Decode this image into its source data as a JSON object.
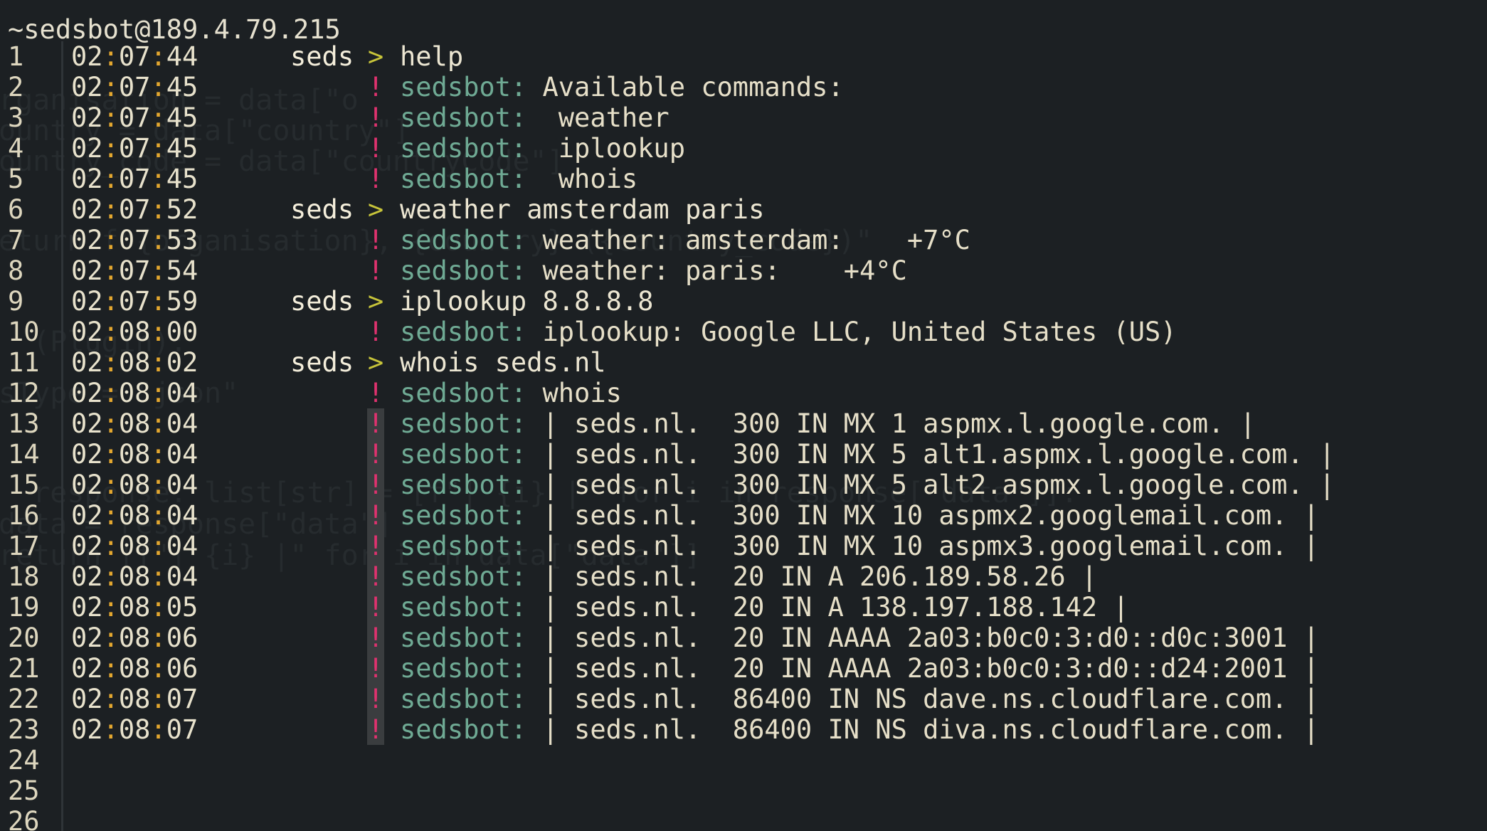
{
  "window": {
    "title": "~sedsbot@189.4.79.215"
  },
  "colors": {
    "background": "#1c2023",
    "timestamp_colon": "#e3a72f",
    "prompt_marker": "#c7c43a",
    "bot_marker": "#e0326f",
    "bot_nick": "#6faa94",
    "text": "#e6dfc8"
  },
  "lines": [
    {
      "num": "1",
      "h": "02",
      "m": "07",
      "s": "44",
      "nick": "seds",
      "marker": ">",
      "kind": "prompt",
      "text": "help"
    },
    {
      "num": "2",
      "h": "02",
      "m": "07",
      "s": "45",
      "nick": "",
      "marker": "!",
      "kind": "bot",
      "sender": "sedsbot:",
      "text": " Available commands:"
    },
    {
      "num": "3",
      "h": "02",
      "m": "07",
      "s": "45",
      "nick": "",
      "marker": "!",
      "kind": "bot",
      "sender": "sedsbot:",
      "text": "  weather"
    },
    {
      "num": "4",
      "h": "02",
      "m": "07",
      "s": "45",
      "nick": "",
      "marker": "!",
      "kind": "bot",
      "sender": "sedsbot:",
      "text": "  iplookup"
    },
    {
      "num": "5",
      "h": "02",
      "m": "07",
      "s": "45",
      "nick": "",
      "marker": "!",
      "kind": "bot",
      "sender": "sedsbot:",
      "text": "  whois"
    },
    {
      "num": "6",
      "h": "02",
      "m": "07",
      "s": "52",
      "nick": "seds",
      "marker": ">",
      "kind": "prompt",
      "text": "weather amsterdam paris"
    },
    {
      "num": "7",
      "h": "02",
      "m": "07",
      "s": "53",
      "nick": "",
      "marker": "!",
      "kind": "bot",
      "sender": "sedsbot:",
      "text": " weather: amsterdam:    +7°C"
    },
    {
      "num": "8",
      "h": "02",
      "m": "07",
      "s": "54",
      "nick": "",
      "marker": "!",
      "kind": "bot",
      "sender": "sedsbot:",
      "text": " weather: paris:    +4°C"
    },
    {
      "num": "9",
      "h": "02",
      "m": "07",
      "s": "59",
      "nick": "seds",
      "marker": ">",
      "kind": "prompt",
      "text": "iplookup 8.8.8.8"
    },
    {
      "num": "10",
      "h": "02",
      "m": "08",
      "s": "00",
      "nick": "",
      "marker": "!",
      "kind": "bot",
      "sender": "sedsbot:",
      "text": " iplookup: Google LLC, United States (US)"
    },
    {
      "num": "11",
      "h": "02",
      "m": "08",
      "s": "02",
      "nick": "seds",
      "marker": ">",
      "kind": "prompt",
      "text": "whois seds.nl"
    },
    {
      "num": "12",
      "h": "02",
      "m": "08",
      "s": "04",
      "nick": "",
      "marker": "!",
      "kind": "bot",
      "sender": "sedsbot:",
      "text": " whois"
    },
    {
      "num": "13",
      "h": "02",
      "m": "08",
      "s": "04",
      "nick": "",
      "marker": "!",
      "kind": "bot-hl",
      "sender": "sedsbot:",
      "text": " | seds.nl.  300 IN MX 1 aspmx.l.google.com. |"
    },
    {
      "num": "14",
      "h": "02",
      "m": "08",
      "s": "04",
      "nick": "",
      "marker": "!",
      "kind": "bot-hl",
      "sender": "sedsbot:",
      "text": " | seds.nl.  300 IN MX 5 alt1.aspmx.l.google.com. |"
    },
    {
      "num": "15",
      "h": "02",
      "m": "08",
      "s": "04",
      "nick": "",
      "marker": "!",
      "kind": "bot-hl",
      "sender": "sedsbot:",
      "text": " | seds.nl.  300 IN MX 5 alt2.aspmx.l.google.com. |"
    },
    {
      "num": "16",
      "h": "02",
      "m": "08",
      "s": "04",
      "nick": "",
      "marker": "!",
      "kind": "bot-hl",
      "sender": "sedsbot:",
      "text": " | seds.nl.  300 IN MX 10 aspmx2.googlemail.com. |"
    },
    {
      "num": "17",
      "h": "02",
      "m": "08",
      "s": "04",
      "nick": "",
      "marker": "!",
      "kind": "bot-hl",
      "sender": "sedsbot:",
      "text": " | seds.nl.  300 IN MX 10 aspmx3.googlemail.com. |"
    },
    {
      "num": "18",
      "h": "02",
      "m": "08",
      "s": "04",
      "nick": "",
      "marker": "!",
      "kind": "bot-hl",
      "sender": "sedsbot:",
      "text": " | seds.nl.  20 IN A 206.189.58.26 |"
    },
    {
      "num": "19",
      "h": "02",
      "m": "08",
      "s": "05",
      "nick": "",
      "marker": "!",
      "kind": "bot-hl",
      "sender": "sedsbot:",
      "text": " | seds.nl.  20 IN A 138.197.188.142 |"
    },
    {
      "num": "20",
      "h": "02",
      "m": "08",
      "s": "06",
      "nick": "",
      "marker": "!",
      "kind": "bot-hl",
      "sender": "sedsbot:",
      "text": " | seds.nl.  20 IN AAAA 2a03:b0c0:3:d0::d0c:3001 |"
    },
    {
      "num": "21",
      "h": "02",
      "m": "08",
      "s": "06",
      "nick": "",
      "marker": "!",
      "kind": "bot-hl",
      "sender": "sedsbot:",
      "text": " | seds.nl.  20 IN AAAA 2a03:b0c0:3:d0::d24:2001 |"
    },
    {
      "num": "22",
      "h": "02",
      "m": "08",
      "s": "07",
      "nick": "",
      "marker": "!",
      "kind": "bot-hl",
      "sender": "sedsbot:",
      "text": " | seds.nl.  86400 IN NS dave.ns.cloudflare.com. |"
    },
    {
      "num": "23",
      "h": "02",
      "m": "08",
      "s": "07",
      "nick": "",
      "marker": "!",
      "kind": "bot-hl",
      "sender": "sedsbot:",
      "text": " | seds.nl.  86400 IN NS diva.ns.cloudflare.com. |"
    },
    {
      "num": "24",
      "kind": "empty"
    },
    {
      "num": "25",
      "kind": "empty"
    },
    {
      "num": "26",
      "kind": "empty"
    }
  ]
}
